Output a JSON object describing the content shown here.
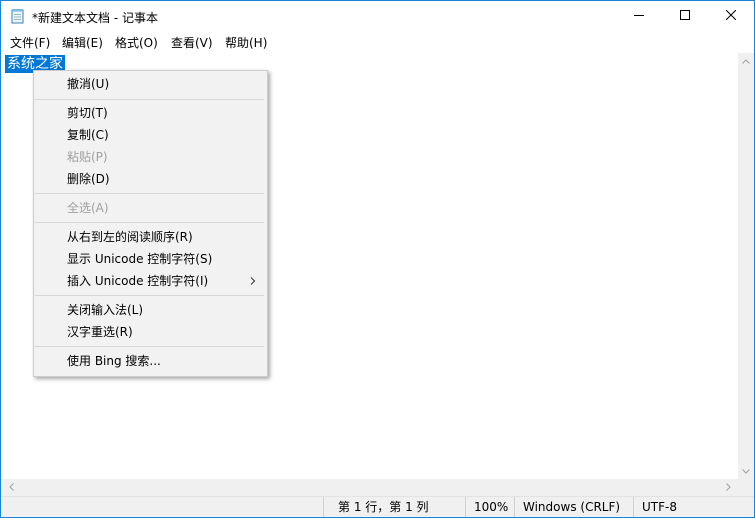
{
  "window": {
    "title": "*新建文本文档 - 记事本"
  },
  "menubar": {
    "items": [
      {
        "label": "文件(F)"
      },
      {
        "label": "编辑(E)"
      },
      {
        "label": "格式(O)"
      },
      {
        "label": "查看(V)"
      },
      {
        "label": "帮助(H)"
      }
    ]
  },
  "editor": {
    "selected_text": "系统之家"
  },
  "context_menu": {
    "undo": "撤消(U)",
    "cut": "剪切(T)",
    "copy": "复制(C)",
    "paste": "粘贴(P)",
    "delete": "删除(D)",
    "select_all": "全选(A)",
    "rtl": "从右到左的阅读顺序(R)",
    "show_unicode": "显示 Unicode 控制字符(S)",
    "insert_unicode": "插入 Unicode 控制字符(I)",
    "close_ime": "关闭输入法(L)",
    "reconversion": "汉字重选(R)",
    "bing_search": "使用 Bing 搜索...",
    "disabled_items": [
      "paste",
      "select_all"
    ]
  },
  "statusbar": {
    "position": "第 1 行，第 1 列",
    "zoom": "100%",
    "line_ending": "Windows (CRLF)",
    "encoding": "UTF-8"
  },
  "colors": {
    "selection": "#0078d7",
    "window_border": "#1883d7",
    "disabled_text": "#a0a0a0"
  },
  "icons": {
    "app": "notepad-icon",
    "minimize": "minimize-icon",
    "maximize": "maximize-icon",
    "close": "close-icon",
    "submenu": "chevron-right-icon"
  }
}
